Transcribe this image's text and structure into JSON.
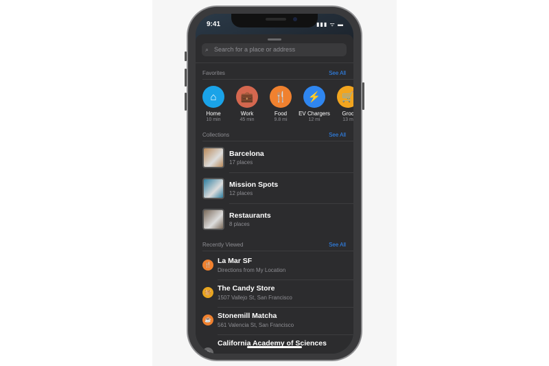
{
  "status": {
    "time": "9:41",
    "icons": "▮▮▮ ᯤ ▬"
  },
  "search": {
    "placeholder": "Search for a place or address"
  },
  "favorites": {
    "header": "Favorites",
    "see_all": "See All",
    "items": [
      {
        "label": "Home",
        "sub": "10 min",
        "icon": "house-icon",
        "color": "#1aa3e8",
        "glyph": "⌂"
      },
      {
        "label": "Work",
        "sub": "45 min",
        "icon": "briefcase-icon",
        "color": "#d4674f",
        "glyph": "💼"
      },
      {
        "label": "Food",
        "sub": "9.8 mi",
        "icon": "fork-knife-icon",
        "color": "#f0812f",
        "glyph": "🍴"
      },
      {
        "label": "EV Chargers",
        "sub": "12 mi",
        "icon": "ev-plug-icon",
        "color": "#2f86f0",
        "glyph": "⚡"
      },
      {
        "label": "Groc",
        "sub": "13 m",
        "icon": "cart-icon",
        "color": "#f2a51f",
        "glyph": "🛒"
      }
    ]
  },
  "collections": {
    "header": "Collections",
    "see_all": "See All",
    "items": [
      {
        "title": "Barcelona",
        "sub": "17 places",
        "color": "#b98a5a"
      },
      {
        "title": "Mission Spots",
        "sub": "12 places",
        "color": "#2f7fa0"
      },
      {
        "title": "Restaurants",
        "sub": "8 places",
        "color": "#7a6a5a"
      }
    ]
  },
  "recent": {
    "header": "Recently Viewed",
    "see_all": "See All",
    "items": [
      {
        "title": "La Mar SF",
        "sub": "Directions from My Location",
        "icon": "fork-knife-icon",
        "color": "#f0812f",
        "glyph": "🍴"
      },
      {
        "title": "The Candy Store",
        "sub": "1507 Vallejo St, San Francisco",
        "icon": "basket-icon",
        "color": "#e8a51f",
        "glyph": "🧺"
      },
      {
        "title": "Stonemill Matcha",
        "sub": "561 Valencia St, San Francisco",
        "icon": "cup-icon",
        "color": "#f0812f",
        "glyph": "☕"
      },
      {
        "title": "California Academy of Sciences",
        "sub": "",
        "icon": "star-icon",
        "color": "#6a6a6c",
        "glyph": "★"
      }
    ]
  }
}
